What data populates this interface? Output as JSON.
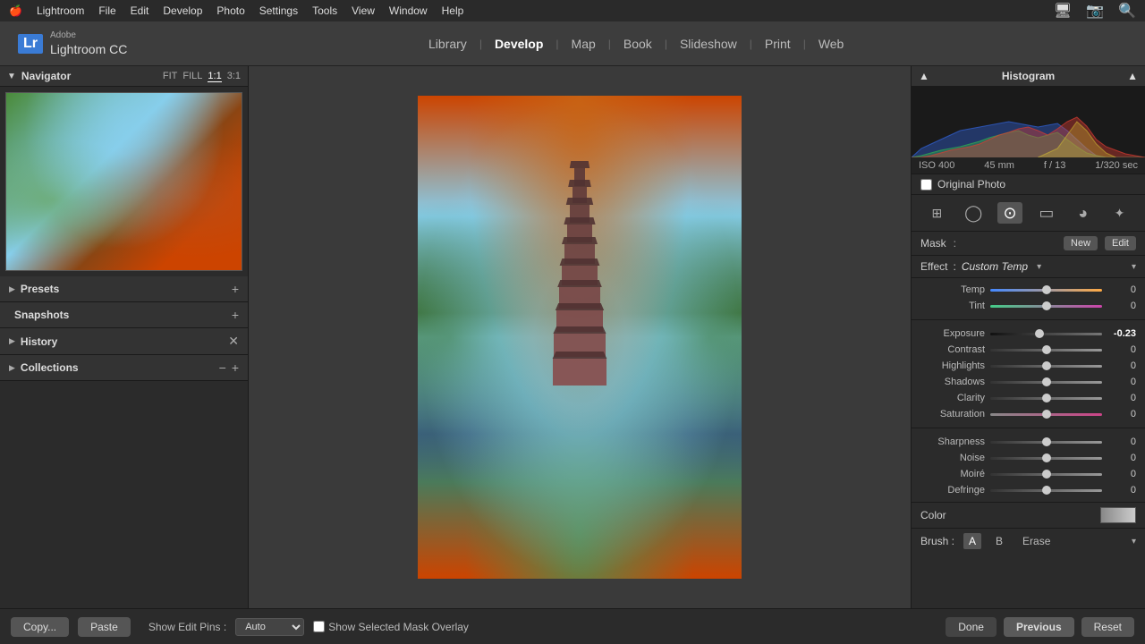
{
  "app": {
    "name": "Lightroom CC",
    "version": "Adobe",
    "badge": "Lr"
  },
  "menubar": {
    "apple": "🍎",
    "items": [
      "Lightroom",
      "File",
      "Edit",
      "Develop",
      "Photo",
      "Settings",
      "Tools",
      "View",
      "Window",
      "Help"
    ]
  },
  "topnav": {
    "items": [
      "Library",
      "Develop",
      "Map",
      "Book",
      "Slideshow",
      "Print",
      "Web"
    ],
    "active": "Develop",
    "separator": "|"
  },
  "navigator": {
    "title": "Navigator",
    "zoom_fit": "FIT",
    "zoom_fill": "FILL",
    "zoom_1_1": "1:1",
    "zoom_3_1": "3:1"
  },
  "left_panel": {
    "presets": {
      "label": "Presets",
      "expanded": true
    },
    "snapshots": {
      "label": "Snapshots",
      "expanded": false
    },
    "history": {
      "label": "History",
      "expanded": false
    },
    "collections": {
      "label": "Collections",
      "expanded": false
    }
  },
  "histogram": {
    "title": "Histogram",
    "iso": "ISO 400",
    "focal": "45 mm",
    "aperture": "f / 13",
    "shutter": "1/320 sec"
  },
  "original_photo": {
    "label": "Original Photo",
    "checked": false
  },
  "tools": [
    {
      "name": "grid-icon",
      "symbol": "⊞",
      "active": false
    },
    {
      "name": "circle-tool-icon",
      "symbol": "◯",
      "active": false
    },
    {
      "name": "radial-filter-icon",
      "symbol": "⊙",
      "active": true
    },
    {
      "name": "rect-tool-icon",
      "symbol": "▭",
      "active": false
    },
    {
      "name": "vignette-icon",
      "symbol": "◕",
      "active": false
    },
    {
      "name": "adjustment-icon",
      "symbol": "✦",
      "active": false
    }
  ],
  "mask": {
    "label": "Mask",
    "colon": ":",
    "new_btn": "New",
    "edit_btn": "Edit"
  },
  "effect": {
    "label": "Effect",
    "colon": ":",
    "value": "Custom",
    "sub_label": "Temp"
  },
  "sliders": {
    "temp": {
      "label": "Temp",
      "value": "0",
      "position": 0.5
    },
    "tint": {
      "label": "Tint",
      "value": "0",
      "position": 0.5
    },
    "exposure": {
      "label": "Exposure",
      "value": "-0.23",
      "position": 0.44
    },
    "contrast": {
      "label": "Contrast",
      "value": "0",
      "position": 0.5
    },
    "highlights": {
      "label": "Highlights",
      "value": "0",
      "position": 0.5
    },
    "shadows": {
      "label": "Shadows",
      "value": "0",
      "position": 0.5
    },
    "clarity": {
      "label": "Clarity",
      "value": "0",
      "position": 0.5
    },
    "saturation": {
      "label": "Saturation",
      "value": "0",
      "position": 0.5
    },
    "sharpness": {
      "label": "Sharpness",
      "value": "0",
      "position": 0.5
    },
    "noise": {
      "label": "Noise",
      "value": "0",
      "position": 0.5
    },
    "moire": {
      "label": "Moiré",
      "value": "0",
      "position": 0.5
    },
    "defringe": {
      "label": "Defringe",
      "value": "0",
      "position": 0.5
    }
  },
  "color": {
    "label": "Color"
  },
  "brush": {
    "label": "Brush",
    "colon": ":",
    "options": [
      "A",
      "B",
      "Erase"
    ]
  },
  "bottom_bar": {
    "copy_btn": "Copy...",
    "paste_btn": "Paste",
    "pins_label": "Show Edit Pins :",
    "pins_value": "Auto",
    "overlay_label": "Show Selected Mask Overlay",
    "done_btn": "Done",
    "previous_btn": "Previous",
    "reset_btn": "Reset"
  }
}
